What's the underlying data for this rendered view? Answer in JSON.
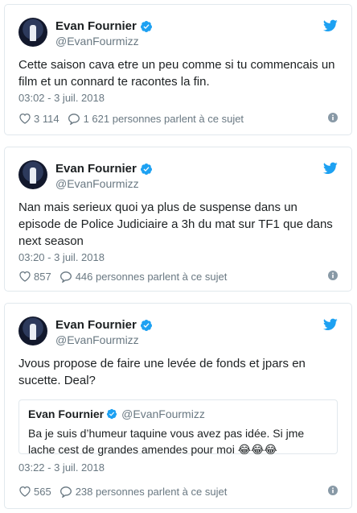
{
  "colors": {
    "text": "#1c2022",
    "muted": "#697882",
    "border": "#e1e8ed",
    "twitter_blue": "#1da1f2",
    "verified_blue": "#1da1f2"
  },
  "tweets": [
    {
      "name": "Evan Fournier",
      "handle": "@EvanFourmizz",
      "text": "Cette saison cava etre un peu comme si tu commencais un film et un connard te racontes la fin.",
      "date": "03:02 - 3 juil. 2018",
      "likes": "3 114",
      "replies": "1 621 personnes parlent à ce sujet"
    },
    {
      "name": "Evan Fournier",
      "handle": "@EvanFourmizz",
      "text": "Nan mais serieux quoi ya plus de suspense dans un episode de Police Judiciaire a 3h du mat sur TF1 que dans next season",
      "date": "03:20 - 3 juil. 2018",
      "likes": "857",
      "replies": "446 personnes parlent à ce sujet"
    },
    {
      "name": "Evan Fournier",
      "handle": "@EvanFourmizz",
      "text": "Jvous propose de faire une levée de fonds et jpars en sucette. Deal?",
      "quote": {
        "name": "Evan Fournier",
        "handle": "@EvanFourmizz",
        "text": "Ba je suis d’humeur taquine vous avez pas idée. Si jme lache cest de grandes amendes pour moi 😂😂😂"
      },
      "date": "03:22 - 3 juil. 2018",
      "likes": "565",
      "replies": "238 personnes parlent à ce sujet"
    }
  ]
}
